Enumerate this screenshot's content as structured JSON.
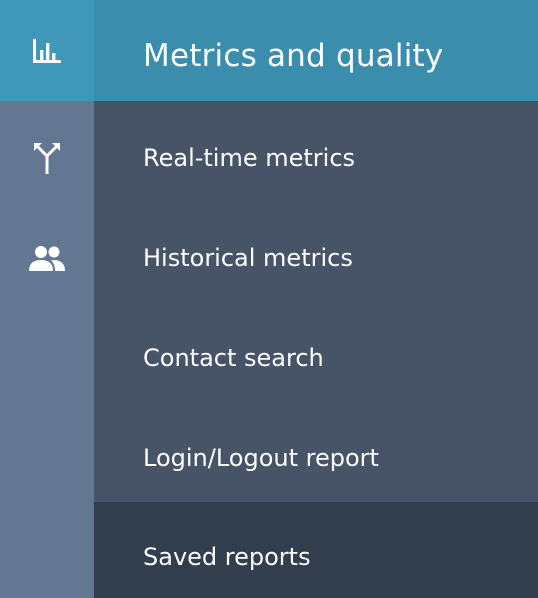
{
  "rail": {
    "items": [
      {
        "icon": "bar-chart-icon",
        "active": true
      },
      {
        "icon": "routing-icon",
        "active": false
      },
      {
        "icon": "users-icon",
        "active": false
      }
    ]
  },
  "panel": {
    "title": "Metrics and quality",
    "items": [
      {
        "label": "Real-time metrics"
      },
      {
        "label": "Historical metrics"
      },
      {
        "label": "Contact search"
      },
      {
        "label": "Login/Logout report"
      },
      {
        "label": "Saved reports",
        "selected": true
      }
    ]
  },
  "colors": {
    "rail_bg": "#637793",
    "rail_active": "#3f98b9",
    "panel_bg": "#475366",
    "panel_header": "#3a8dad",
    "selected_item": "#323d4d",
    "text": "#ffffff"
  }
}
